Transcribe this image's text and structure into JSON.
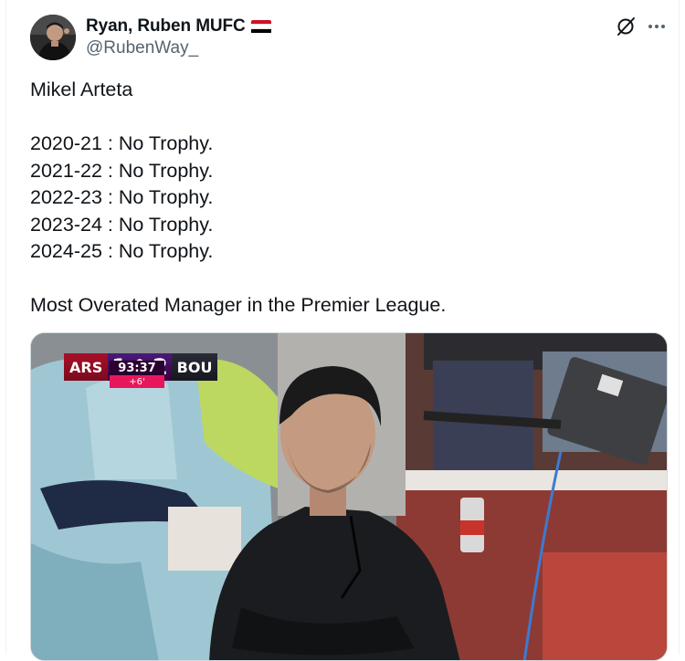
{
  "author": {
    "display_name": "Ryan, Ruben MUFC",
    "handle": "@RubenWay_",
    "flag": "yemen-flag",
    "avatar": "profile-avatar"
  },
  "header_icons": [
    "grok-icon",
    "more-icon"
  ],
  "tweet": {
    "lines": [
      "Mikel Arteta",
      "",
      "2020-21 : No Trophy.",
      "2021-22 : No Trophy.",
      "2022-23 : No Trophy.",
      "2023-24 : No Trophy.",
      "2024-25 : No Trophy.",
      "",
      "Most Overated Manager in the Premier League."
    ]
  },
  "media": {
    "scoreboard": {
      "home_team": "ARS",
      "home_score": "1",
      "away_score": "2",
      "away_team": "BOU",
      "clock": "93:37",
      "added_time": "+6'"
    }
  },
  "colors": {
    "text_primary": "#0f1419",
    "text_secondary": "#536471",
    "border": "#cfd9de"
  }
}
